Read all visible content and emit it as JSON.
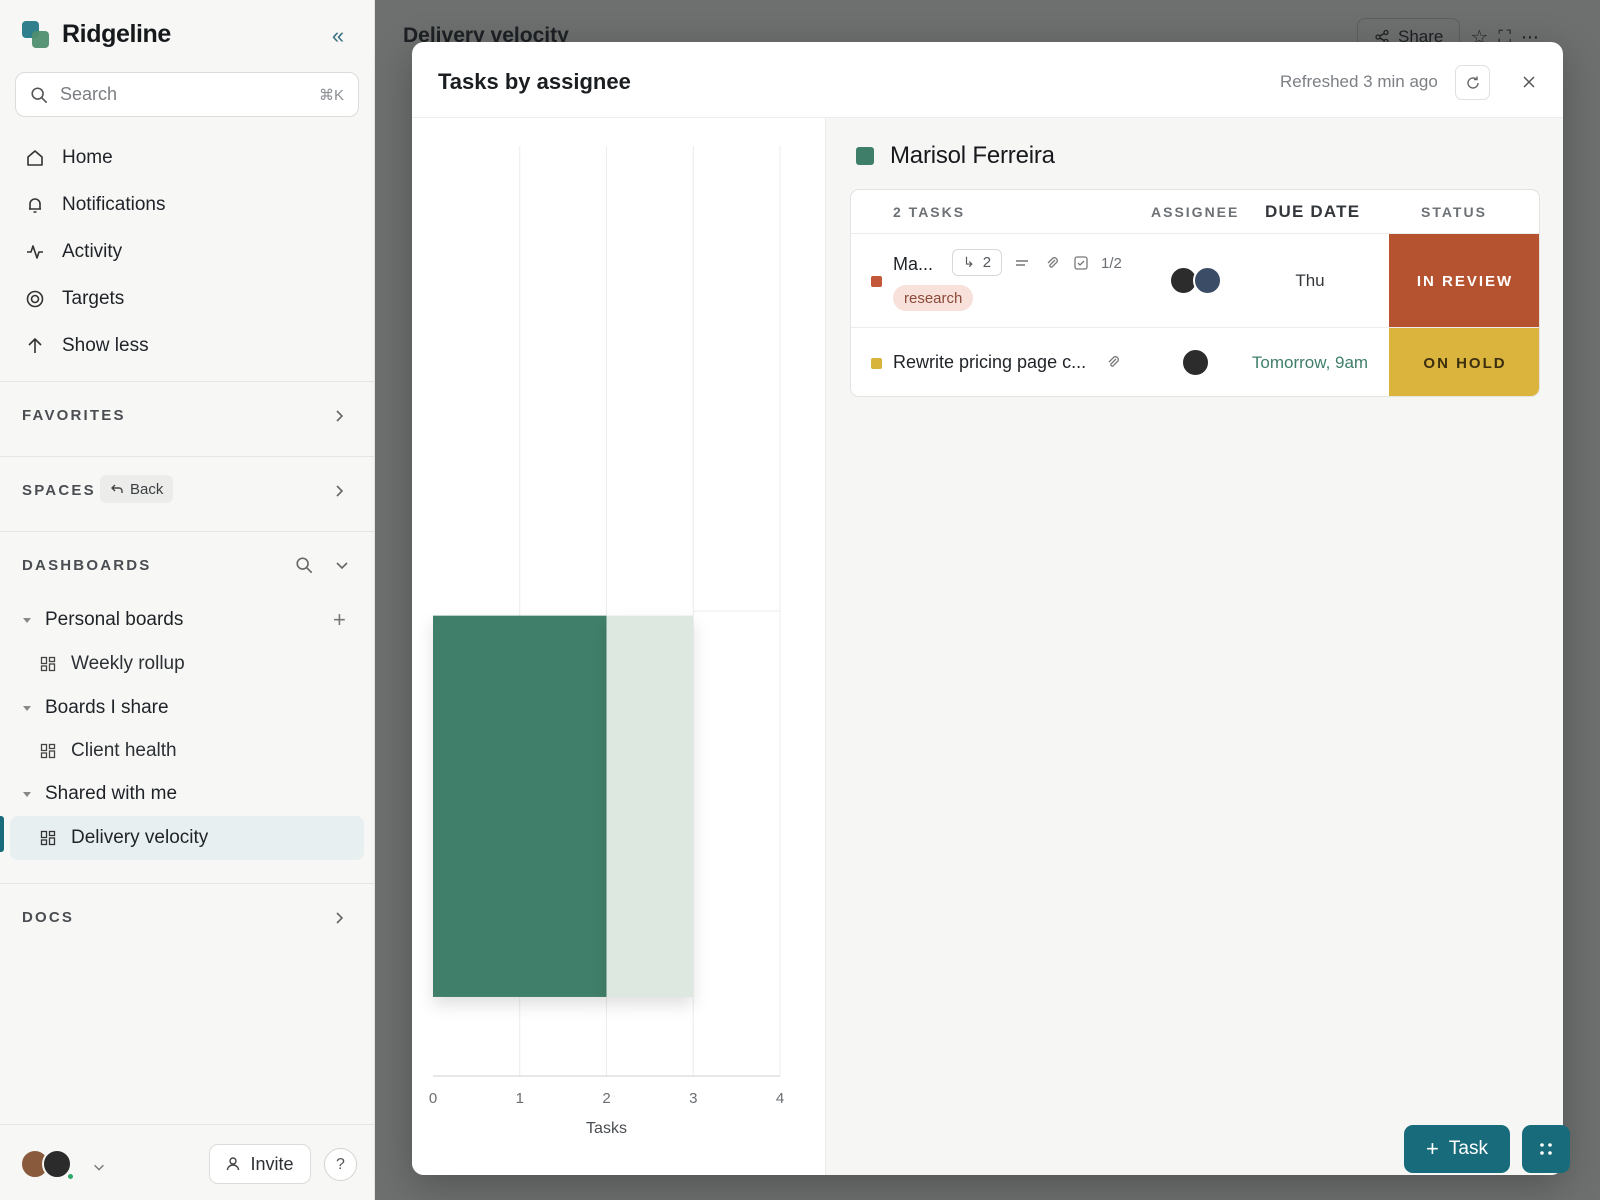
{
  "app": {
    "name": "Ridgeline"
  },
  "sidebar": {
    "search": {
      "placeholder": "Search",
      "shortcut": "⌘K"
    },
    "nav": [
      {
        "label": "Home",
        "icon": "home-icon"
      },
      {
        "label": "Notifications",
        "icon": "bell-icon"
      },
      {
        "label": "Activity",
        "icon": "activity-icon"
      },
      {
        "label": "Targets",
        "icon": "target-icon"
      },
      {
        "label": "Show less",
        "icon": "arrow-up-icon"
      }
    ],
    "favorites_title": "FAVORITES",
    "spaces_title": "SPACES",
    "spaces_back": "Back",
    "dashboards_title": "DASHBOARDS",
    "tree": [
      {
        "group": "Personal boards",
        "items": [
          "Weekly rollup"
        ]
      },
      {
        "group": "Boards I share",
        "items": [
          "Client health"
        ]
      },
      {
        "group": "Shared with me",
        "items": [
          "Delivery velocity"
        ]
      }
    ],
    "docs_title": "DOCS",
    "invite_label": "Invite",
    "help_label": "?"
  },
  "page": {
    "title": "Delivery velocity",
    "share_label": "Share"
  },
  "modal": {
    "title": "Tasks by assignee",
    "refreshed": "Refreshed 3 min ago",
    "assignee": {
      "name": "Marisol Ferreira",
      "color": "#3f7f69"
    },
    "table": {
      "count_label": "2 TASKS",
      "col_assignee": "ASSIGNEE",
      "col_due": "DUE DATE",
      "col_status": "STATUS",
      "rows": [
        {
          "name": "Ma...",
          "priority_color": "#c2573a",
          "subtasks": "2",
          "checklist": "1/2",
          "tag": "research",
          "due": "Thu",
          "due_color": "#33373b",
          "status": "IN REVIEW",
          "status_bg": "#b5522f",
          "status_fg": "#ffffff"
        },
        {
          "name": "Rewrite pricing page c...",
          "priority_color": "#d9b43b",
          "due": "Tomorrow, 9am",
          "due_color": "#3f7f69",
          "status": "ON HOLD",
          "status_bg": "#dbb43d",
          "status_fg": "#3b2f0f"
        }
      ]
    }
  },
  "chart_data": {
    "type": "bar",
    "orientation": "horizontal",
    "stacked": true,
    "xlabel": "Tasks",
    "xlim": [
      0,
      4
    ],
    "xticks": [
      "0",
      "1",
      "2",
      "3",
      "4"
    ],
    "categories": [
      "",
      ""
    ],
    "series": [
      {
        "values": [
          null,
          2
        ],
        "color": "#3f7f69"
      },
      {
        "values": [
          null,
          1
        ],
        "color": "#dde8e1"
      }
    ],
    "grid": true
  },
  "actions": {
    "task_label": "Task"
  }
}
